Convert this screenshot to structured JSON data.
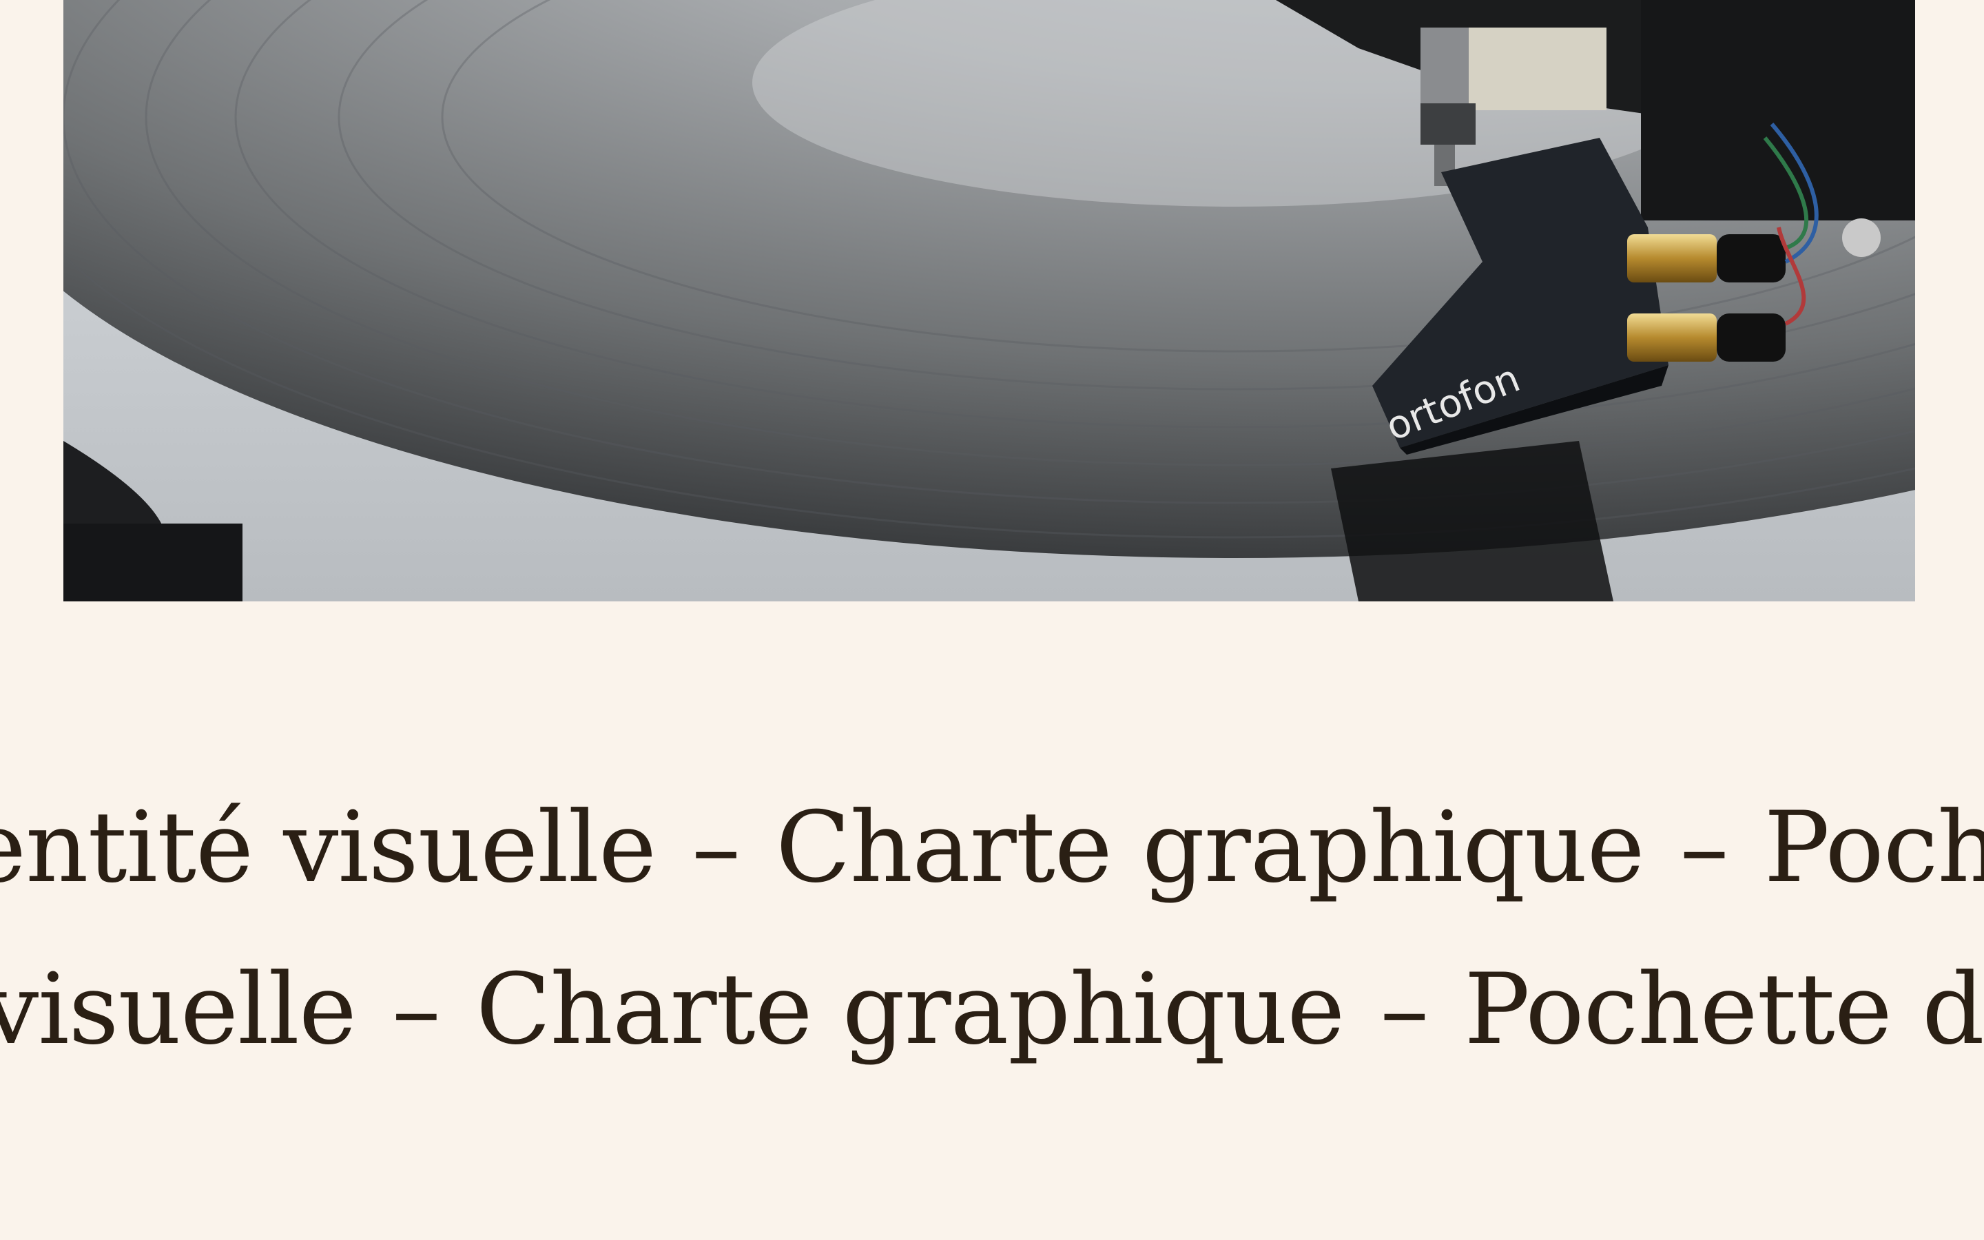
{
  "hero": {
    "image_alt": "Turntable stylus on a vinyl record",
    "cartridge_brand": "ortofon"
  },
  "marquee": {
    "row1": {
      "item1": "entité visuelle",
      "item2": "Charte graphique",
      "item3": "Pochette d'"
    },
    "row2": {
      "item1": "visuelle",
      "item2": "Charte graphique",
      "item3": "Pochette d'album"
    },
    "separator": "–"
  },
  "colors": {
    "background": "#faf3eb",
    "text": "#2a1f14"
  }
}
